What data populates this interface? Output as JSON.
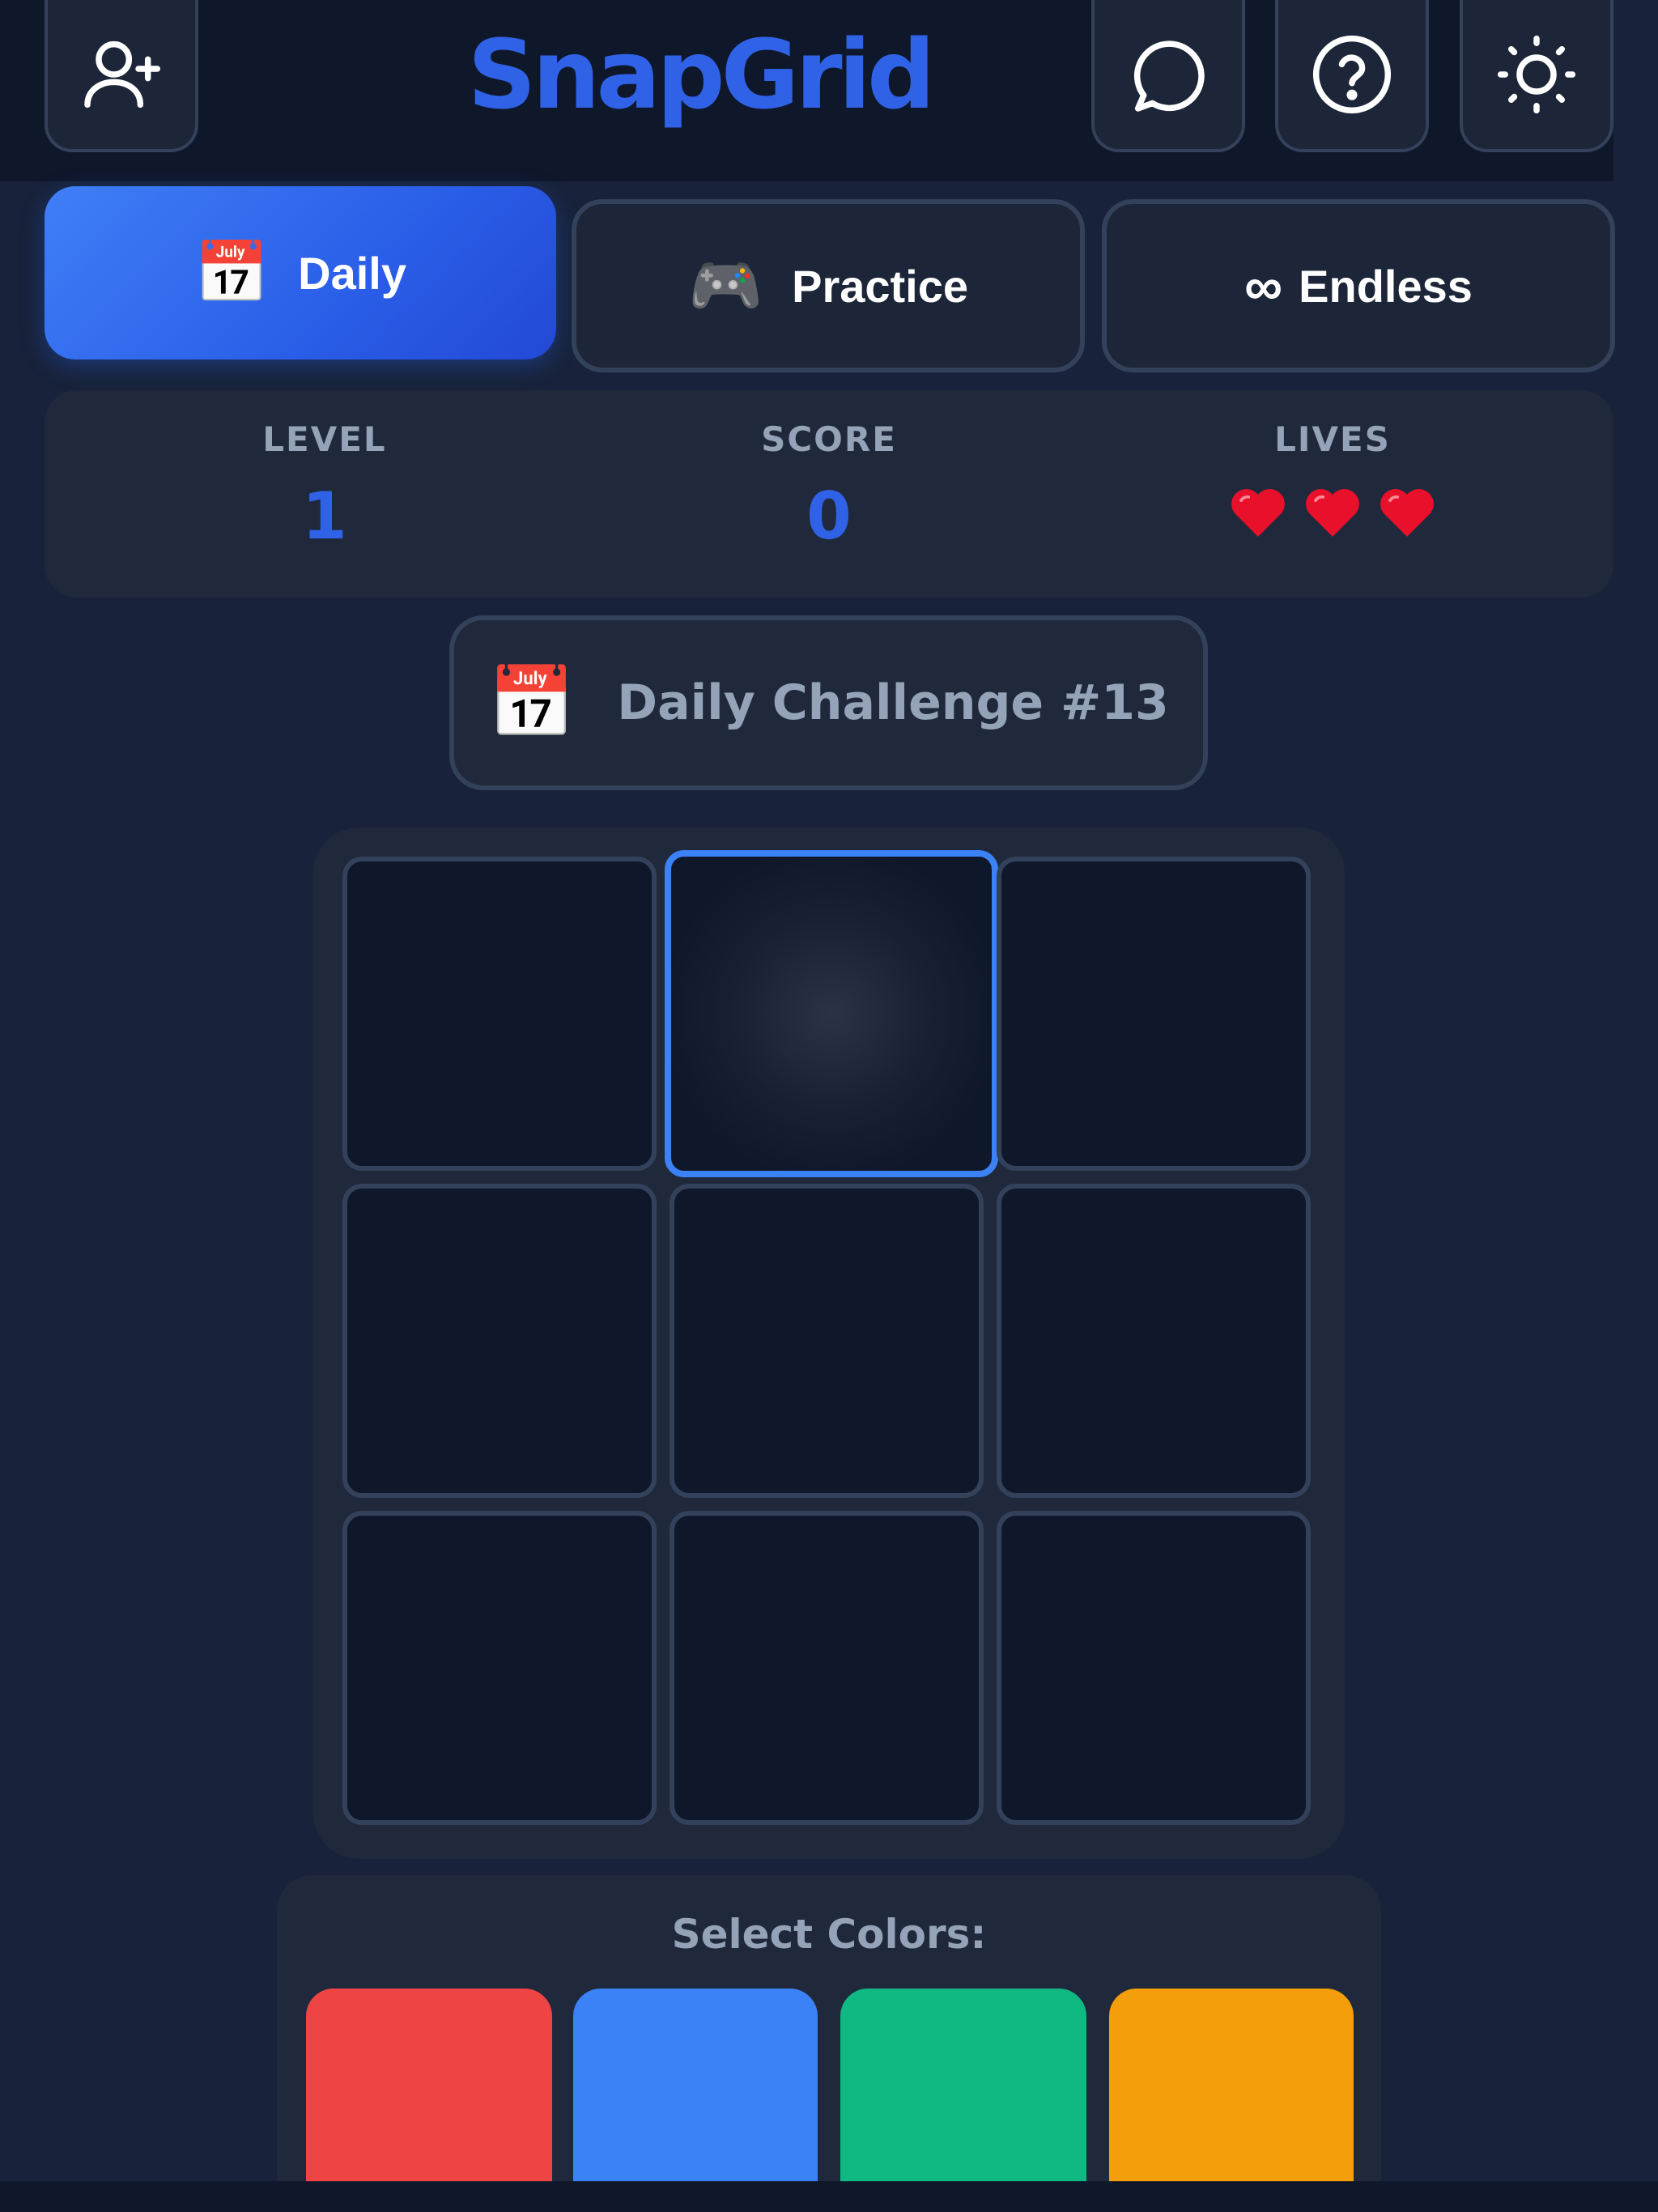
{
  "app": {
    "title": "SnapGrid"
  },
  "header": {
    "buttons": [
      {
        "name": "add-user",
        "icon": "user-plus-icon"
      },
      {
        "name": "chat",
        "icon": "chat-bubble-icon"
      },
      {
        "name": "help",
        "icon": "question-circle-icon"
      },
      {
        "name": "theme",
        "icon": "sun-icon"
      }
    ]
  },
  "modes": {
    "selected": "Daily",
    "items": [
      {
        "label": "Daily",
        "icon": "📅",
        "icon_name": "calendar-icon"
      },
      {
        "label": "Practice",
        "icon": "🎮",
        "icon_name": "gamepad-icon"
      },
      {
        "label": "Endless",
        "icon": "∞",
        "icon_name": "infinity-icon"
      }
    ]
  },
  "stats": {
    "level": {
      "label": "LEVEL",
      "value": "1"
    },
    "score": {
      "label": "SCORE",
      "value": "0"
    },
    "lives": {
      "label": "LIVES",
      "count": 3,
      "icon_name": "heart-icon"
    }
  },
  "challenge": {
    "icon": "📅",
    "text": "Daily Challenge #13"
  },
  "board": {
    "rows": 3,
    "cols": 3,
    "selected_cell": [
      0,
      1
    ]
  },
  "palette": {
    "title": "Select Colors:",
    "colors": [
      {
        "name": "red",
        "hex": "#ef4444"
      },
      {
        "name": "blue",
        "hex": "#3b82f6"
      },
      {
        "name": "green",
        "hex": "#10b981"
      },
      {
        "name": "orange",
        "hex": "#f59e0b"
      }
    ]
  },
  "theme": {
    "accent": "#2f62e6",
    "background": "#18223a",
    "panel": "#1f293b",
    "border": "#33415a",
    "muted_text": "#94a3b8"
  }
}
